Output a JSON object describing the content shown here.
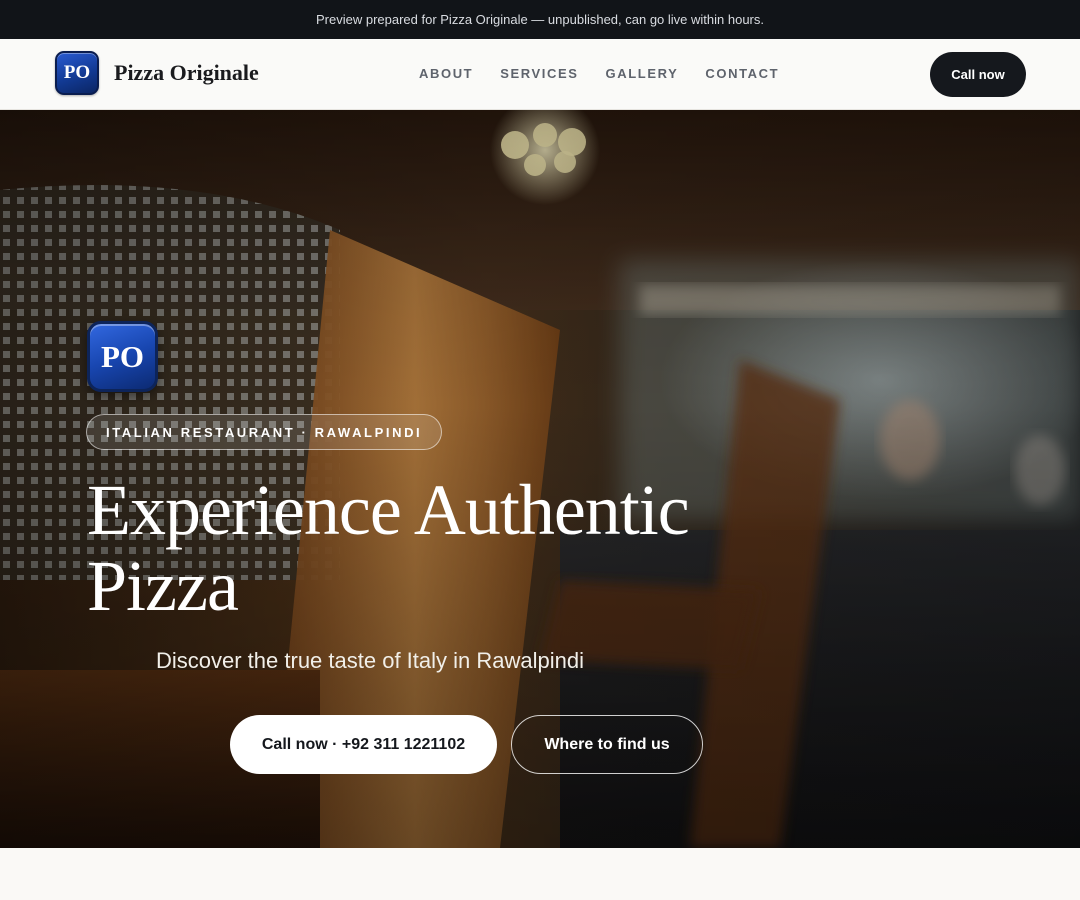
{
  "preview_bar": {
    "text": "Preview prepared for Pizza Originale — unpublished, can go live within hours."
  },
  "nav": {
    "logo_text": "PO",
    "brand_name": "Pizza Originale",
    "links": [
      "ABOUT",
      "SERVICES",
      "GALLERY",
      "CONTACT"
    ],
    "cta_label": "Call now"
  },
  "hero": {
    "logo_text": "PO",
    "tagline": "ITALIAN RESTAURANT · RAWALPINDI",
    "title_line1": "Experience Authentic",
    "title_line2": "Pizza",
    "subtitle": "Discover the true taste of Italy in Rawalpindi",
    "primary_button": "Call now · +92 311 1221102",
    "secondary_button": "Where to find us",
    "background_image": "blurred-restaurant-interior"
  },
  "colors": {
    "brand_blue": "#1846b0",
    "dark": "#15181d",
    "topbar": "#111418"
  }
}
